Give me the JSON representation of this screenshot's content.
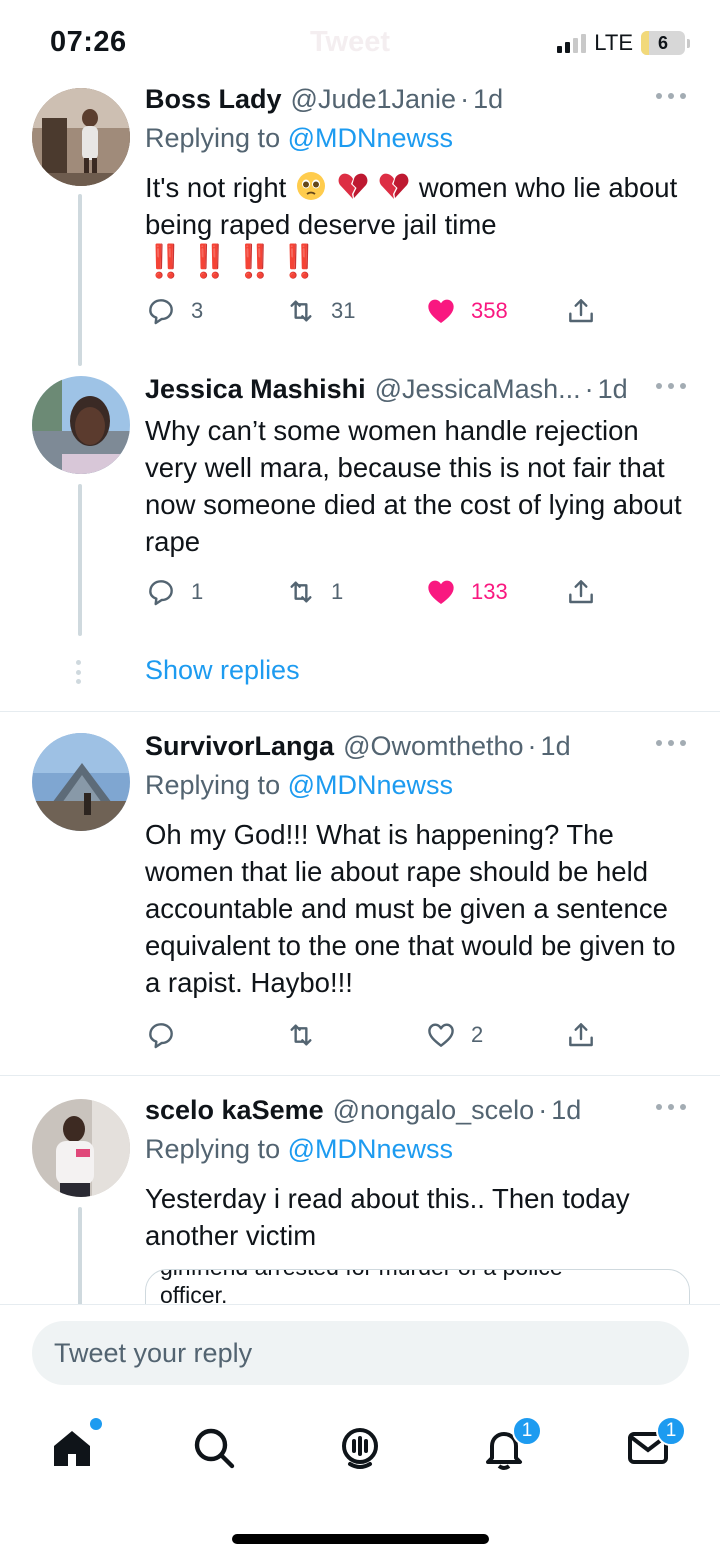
{
  "status_bar": {
    "time": "07:26",
    "header_title": "Tweet",
    "network": "LTE",
    "battery": "6"
  },
  "colors": {
    "accent": "#1d9bf0",
    "like": "#f91880",
    "text": "#0f1419",
    "muted": "#536471"
  },
  "tweets": [
    {
      "name": "Boss Lady",
      "handle": "@Jude1Janie",
      "time": "1d",
      "replying_label": "Replying to",
      "replying_to": "@MDNnewss",
      "text_a": "It's not right",
      "text_b": "women who lie about being raped deserve jail time",
      "emojis": [
        "pleading-face",
        "broken-heart",
        "broken-heart"
      ],
      "bangs": "‼️ ‼️ ‼️ ‼️",
      "replies": "3",
      "retweets": "31",
      "likes": "358",
      "liked": true
    },
    {
      "name": "Jessica Mashishi",
      "handle": "@JessicaMash...",
      "time": "1d",
      "text": "Why can’t some women handle rejection very well mara, because this is not fair that now someone died at the cost of lying about rape",
      "replies": "1",
      "retweets": "1",
      "likes": "133",
      "liked": true
    },
    {
      "name": "SurvivorLanga",
      "handle": "@Owomthetho",
      "time": "1d",
      "replying_label": "Replying to",
      "replying_to": "@MDNnewss",
      "text": "Oh my God!!! What is happening? The women that lie about rape should be held accountable and must be given a sentence equivalent to the one that would be given to a rapist. Haybo!!!",
      "replies": "",
      "retweets": "",
      "likes": "2",
      "liked": false
    },
    {
      "name": "scelo kaSeme",
      "handle": "@nongalo_scelo",
      "time": "1d",
      "replying_label": "Replying to",
      "replying_to": "@MDNnewss",
      "text": "Yesterday i read about this.. Then today another victim",
      "quote_text_top": "girlfriend arrested for murder of a police",
      "quote_text_bottom": "officer."
    }
  ],
  "show_replies": "Show replies",
  "reply_placeholder": "Tweet your reply",
  "tabs": [
    {
      "icon": "home-icon",
      "badge": ""
    },
    {
      "icon": "search-icon",
      "badge": ""
    },
    {
      "icon": "spaces-icon",
      "badge": ""
    },
    {
      "icon": "notifications-icon",
      "badge": "1"
    },
    {
      "icon": "messages-icon",
      "badge": "1"
    }
  ]
}
